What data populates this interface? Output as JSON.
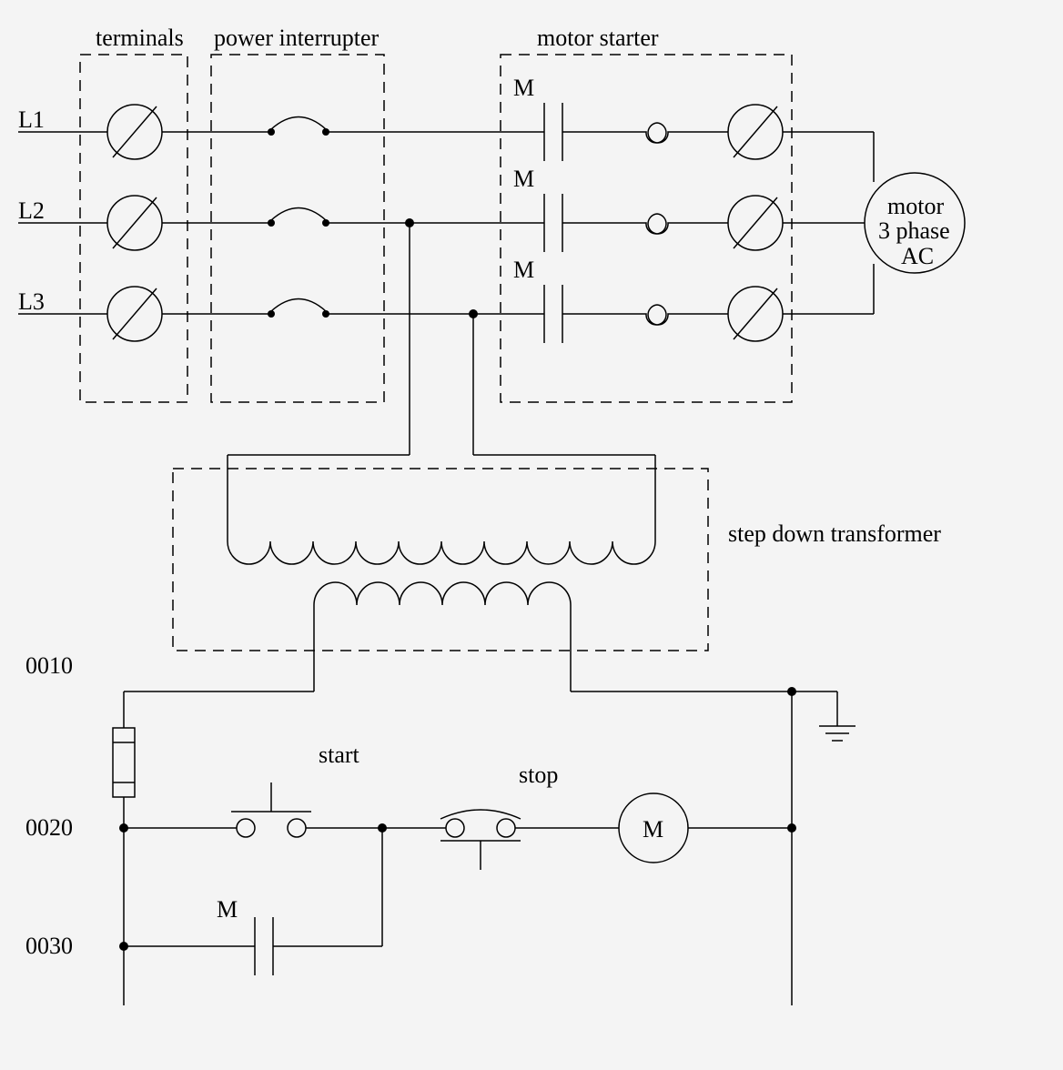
{
  "labels": {
    "terminals": "terminals",
    "power_interrupter": "power interrupter",
    "motor_starter": "motor starter",
    "step_down_transformer": "step down transformer",
    "start": "start",
    "stop": "stop",
    "motor_line1": "motor",
    "motor_line2": "3 phase",
    "motor_line3": "AC"
  },
  "lines": {
    "l1": "L1",
    "l2": "L2",
    "l3": "L3"
  },
  "rungs": {
    "r0010": "0010",
    "r0020": "0020",
    "r0030": "0030"
  },
  "contacts": {
    "m_top1": "M",
    "m_top2": "M",
    "m_top3": "M",
    "m_coil": "M",
    "m_seal": "M"
  }
}
